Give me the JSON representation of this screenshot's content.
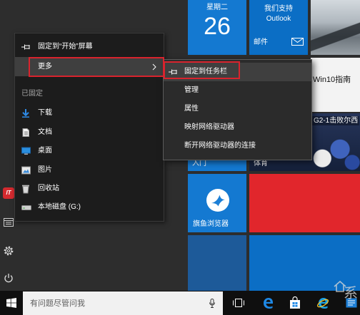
{
  "start_menu": {
    "rail": {
      "avatar_text": "IT",
      "icons": [
        "file-explorer-icon",
        "gear-icon",
        "power-icon"
      ]
    }
  },
  "jump_list": {
    "actions": [
      {
        "label": "固定到“开始”屏幕",
        "icon": "pin-icon"
      },
      {
        "label": "更多",
        "icon": "chevron-right-icon",
        "highlighted": true
      }
    ],
    "pinned_header": "已固定",
    "pinned": [
      {
        "label": "下载",
        "icon": "download-icon"
      },
      {
        "label": "文档",
        "icon": "document-icon"
      },
      {
        "label": "桌面",
        "icon": "desktop-icon"
      },
      {
        "label": "图片",
        "icon": "picture-icon"
      },
      {
        "label": "回收站",
        "icon": "recycle-bin-icon"
      },
      {
        "label": "本地磁盘 (G:)",
        "icon": "drive-icon"
      }
    ]
  },
  "more_submenu": {
    "items": [
      {
        "label": "固定到任务栏",
        "icon": "pin-icon",
        "highlighted": true
      },
      {
        "label": "管理"
      },
      {
        "label": "属性"
      },
      {
        "label": "映射网络驱动器"
      },
      {
        "label": "断开网络驱动器的连接"
      }
    ]
  },
  "tiles": {
    "calendar": {
      "weekday": "星期二",
      "day": "26"
    },
    "mail": {
      "line1": "我们支持",
      "line2": "Outlook",
      "label": "邮件",
      "icon": "mail-icon"
    },
    "news": {
      "headline": "Win10指南"
    },
    "sports": {
      "headline": "G2-1击败尔西",
      "label": "体育"
    },
    "get_started": {
      "label": "入门"
    },
    "browser": {
      "label": "旗鱼浏览器",
      "icon": "sailfish-icon"
    }
  },
  "taskbar": {
    "start_icon": "windows-logo-icon",
    "search_placeholder": "有问题尽管问我",
    "search_icon": "microphone-icon",
    "apps": [
      "task-view-icon",
      "edge-icon",
      "store-icon",
      "internet-explorer-icon",
      "app-icon"
    ]
  },
  "watermark": {
    "text": "系"
  },
  "colors": {
    "start_bg": "#2d2d2d",
    "popup_bg": "#1c1c1c",
    "menu_bg": "#2b2b2b",
    "menu_hover": "#3f3f3f",
    "highlight_box": "#d9232d",
    "tile_blue": "#1479d1",
    "tile_blue_alt": "#0b6ec5",
    "tile_red": "#e1262c",
    "tile_navy": "#1d5a99",
    "taskbar_bg": "#0f0f0f",
    "search_bg": "#f1f1f1",
    "avatar_red": "#d32a2f",
    "news_bg": "#f3f3f3"
  }
}
